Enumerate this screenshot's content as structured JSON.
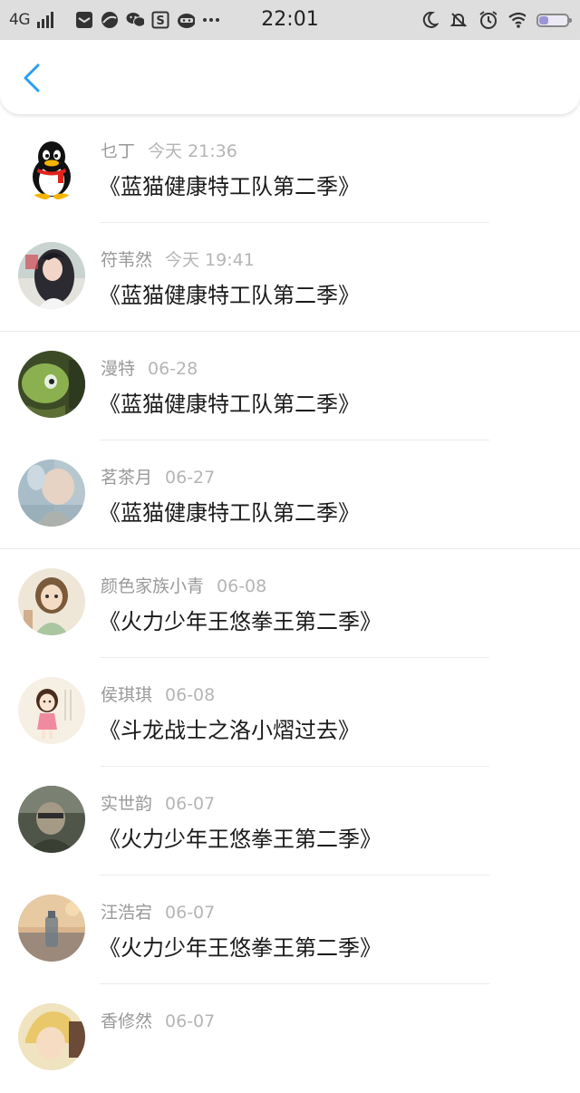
{
  "status_bar": {
    "network": "4G",
    "time": "22:01",
    "battery_level": 0.35,
    "left_icons": [
      "signal-icon",
      "notification-box-icon",
      "browser-icon",
      "wechat-icon",
      "s-app-icon",
      "cat-app-icon",
      "more-dots-icon"
    ],
    "right_icons": [
      "moon-icon",
      "bell-off-icon",
      "alarm-icon",
      "wifi-icon",
      "battery-icon"
    ]
  },
  "navbar": {
    "back_icon": "chevron-left-icon",
    "accent_color": "#2a9df4"
  },
  "messages": [
    {
      "name": "乜丁",
      "date": "今天 21:36",
      "title": "《蓝猫健康特工队第二季》",
      "avatar": "qq-penguin"
    },
    {
      "name": "符苇然",
      "date": "今天 19:41",
      "title": "《蓝猫健康特工队第二季》",
      "avatar": "girl-photo"
    },
    {
      "name": "漫特",
      "date": "06-28",
      "title": "《蓝猫健康特工队第二季》",
      "avatar": "alien-green"
    },
    {
      "name": "茗茶月",
      "date": "06-27",
      "title": "《蓝猫健康特工队第二季》",
      "avatar": "pastel-painting"
    },
    {
      "name": "颜色家族小青",
      "date": "06-08",
      "title": "《火力少年王悠拳王第二季》",
      "avatar": "anime-girl"
    },
    {
      "name": "侯琪琪",
      "date": "06-08",
      "title": "《斗龙战士之洛小熠过去》",
      "avatar": "cartoon-girl"
    },
    {
      "name": "实世韵",
      "date": "06-07",
      "title": "《火力少年王悠拳王第二季》",
      "avatar": "dark-portrait"
    },
    {
      "name": "汪浩宕",
      "date": "06-07",
      "title": "《火力少年王悠拳王第二季》",
      "avatar": "sunset-bottle"
    },
    {
      "name": "香修然",
      "date": "06-07",
      "title": "",
      "avatar": "anime-blond"
    }
  ]
}
